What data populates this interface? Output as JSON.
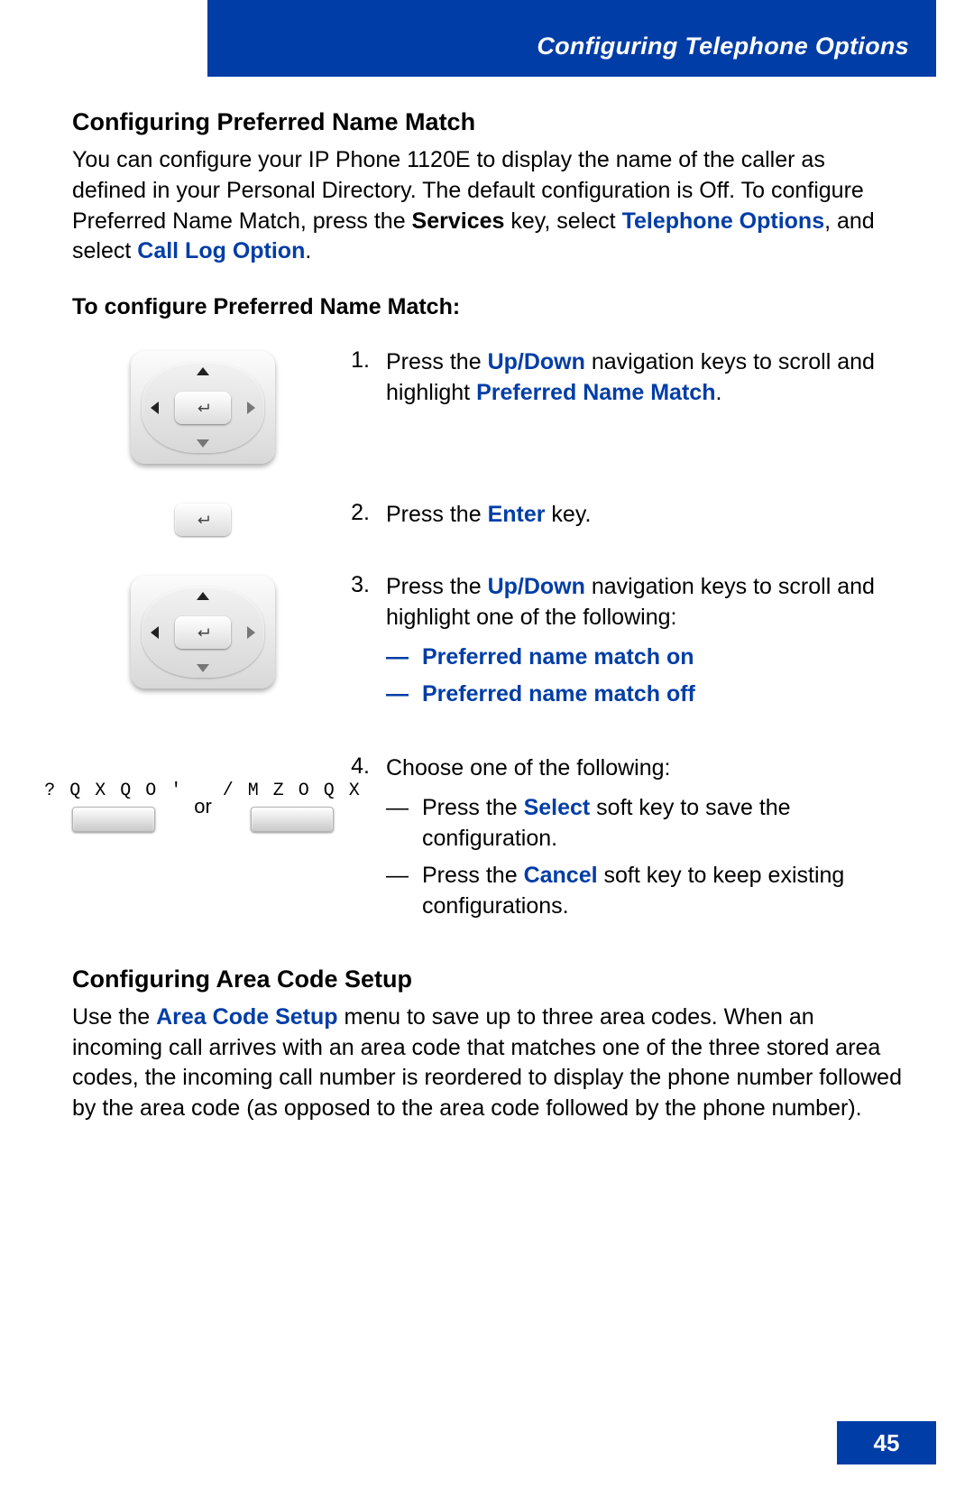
{
  "header": {
    "title": "Configuring Telephone Options"
  },
  "section1": {
    "title": "Configuring Preferred Name Match",
    "intro_pre": "You can configure your IP Phone 1120E to display the name of the caller as defined in your Personal Directory. The default configuration is Off. To configure Preferred Name Match, press the ",
    "kw_services": "Services",
    "intro_mid1": " key, select ",
    "kw_tel_options": "Telephone Options",
    "intro_mid2": ", and select ",
    "kw_call_log": "Call Log Option",
    "intro_post": ".",
    "subtitle": "To configure Preferred Name Match:"
  },
  "steps": {
    "s1": {
      "num": "1.",
      "t_pre": "Press the ",
      "kw_updown": "Up/Down",
      "t_mid": " navigation keys to scroll and highlight ",
      "kw_pnm": "Preferred Name Match",
      "t_post": "."
    },
    "s2": {
      "num": "2.",
      "t_pre": "Press the ",
      "kw_enter": "Enter",
      "t_post": " key."
    },
    "s3": {
      "num": "3.",
      "t_pre": "Press the ",
      "kw_updown": "Up/Down",
      "t_mid": " navigation keys to scroll and highlight one of the following:",
      "opt_dash": "—",
      "opt1": "Preferred name match on",
      "opt2": "Preferred name match off"
    },
    "s4": {
      "num": "4.",
      "t_head": "Choose one of the following:",
      "opt_dash": "—",
      "opt1_pre": "Press the ",
      "opt1_kw": "Select",
      "opt1_post": " soft key to save the configuration.",
      "opt2_pre": "Press the ",
      "opt2_kw": "Cancel",
      "opt2_post": " soft key to keep existing configurations."
    }
  },
  "softkeys": {
    "left_label": "? Q X Q O '",
    "right_label": "/ M Z O Q X",
    "or_text": "or"
  },
  "section2": {
    "title": "Configuring Area Code Setup",
    "body_pre": "Use the ",
    "kw_area": "Area Code Setup",
    "body_post": " menu to save up to three area codes. When an incoming call arrives with an area code that matches one of the three stored area codes, the incoming call number is reordered to display the phone number followed by the area code (as opposed to the area code followed by the phone number)."
  },
  "page_number": "45"
}
